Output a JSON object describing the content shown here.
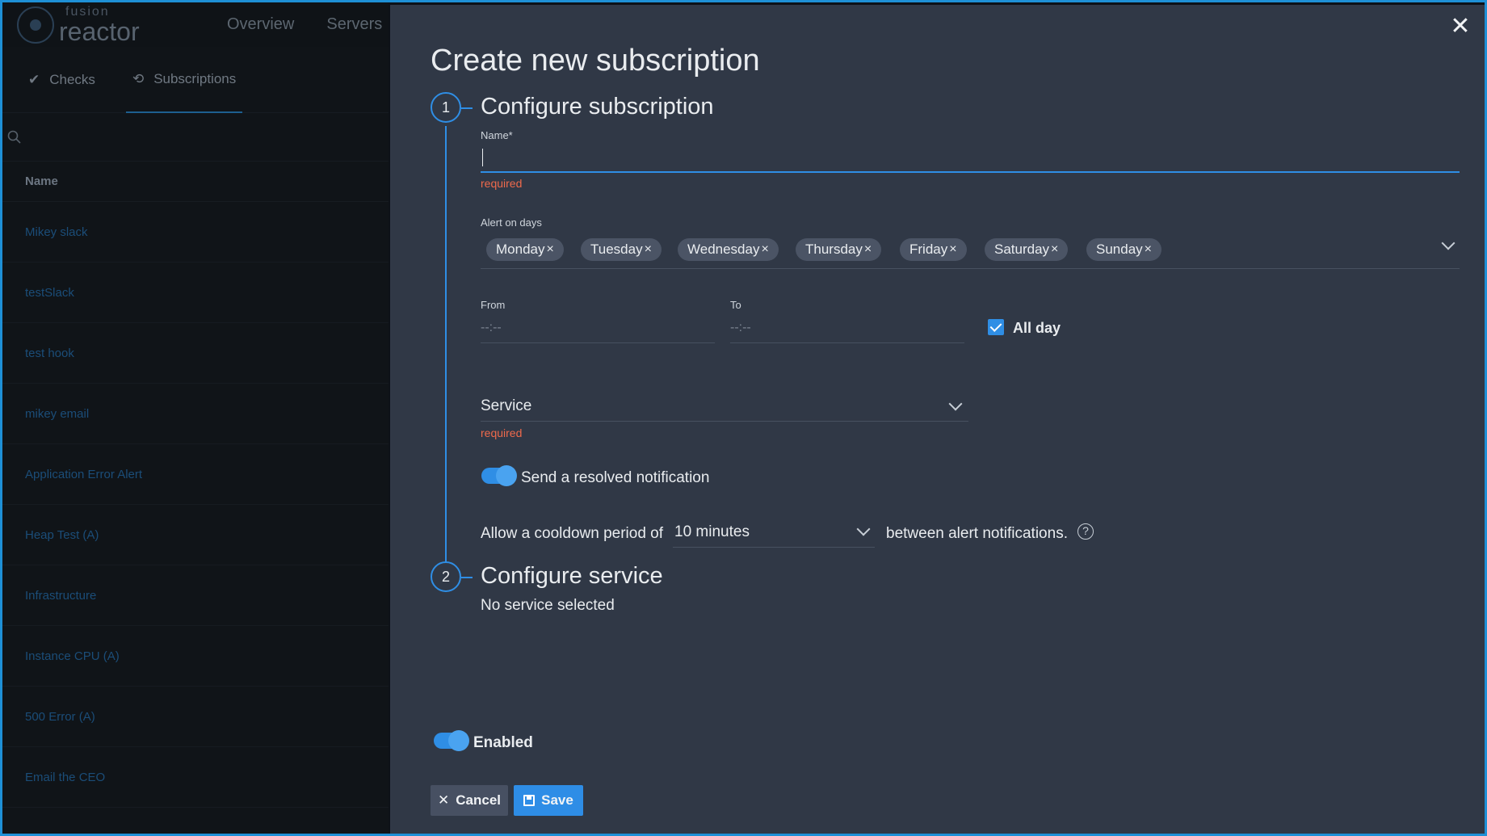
{
  "background": {
    "logo_small": "fusion",
    "logo_big": "reactor",
    "nav": [
      "Overview",
      "Servers"
    ],
    "tabs": [
      {
        "label": "Checks",
        "icon": "check-icon"
      },
      {
        "label": "Subscriptions",
        "icon": "history-icon"
      }
    ],
    "table_header": "Name",
    "rows": [
      "Mikey slack",
      "testSlack",
      "test hook",
      "mikey email",
      "Application Error Alert",
      "Heap Test (A)",
      "Infrastructure",
      "Instance CPU (A)",
      "500 Error (A)",
      "Email the CEO"
    ]
  },
  "modal": {
    "title": "Create new subscription",
    "close_icon": "close-icon",
    "step1": {
      "number": "1",
      "title": "Configure subscription"
    },
    "step2": {
      "number": "2",
      "title": "Configure service"
    },
    "name_label": "Name*",
    "name_value": "",
    "name_error": "required",
    "days_label": "Alert on days",
    "days": [
      "Monday",
      "Tuesday",
      "Wednesday",
      "Thursday",
      "Friday",
      "Saturday",
      "Sunday"
    ],
    "chip_remove": "×",
    "from_label": "From",
    "to_label": "To",
    "from_value": "--:--",
    "to_value": "--:--",
    "all_day_label": "All day",
    "all_day_checked": true,
    "service_label": "Service",
    "service_error": "required",
    "resolved_label": "Send a resolved notification",
    "resolved_enabled": true,
    "cooldown_prefix": "Allow a cooldown period of",
    "cooldown_value": "10 minutes",
    "cooldown_suffix": "between alert notifications.",
    "help_glyph": "?",
    "no_service": "No service selected",
    "enabled_label": "Enabled",
    "enabled": true,
    "cancel_label": "Cancel",
    "cancel_glyph": "✕",
    "save_label": "Save"
  },
  "colors": {
    "accent": "#2f8ee5",
    "error": "#ef6a4c",
    "panel": "#303846",
    "frame": "#1e90d6"
  }
}
